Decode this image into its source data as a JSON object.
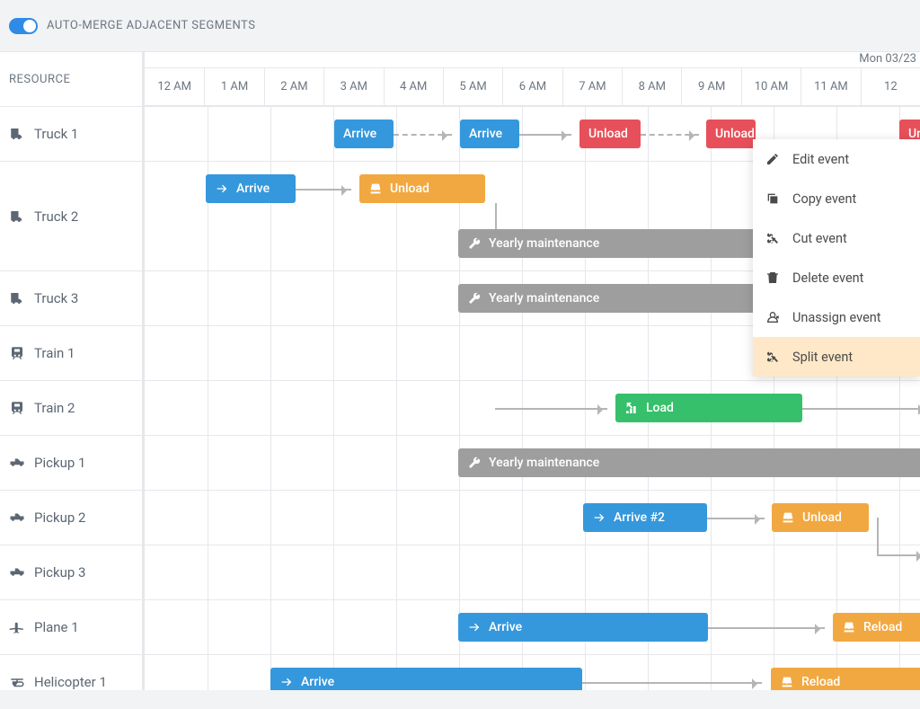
{
  "toolbar": {
    "auto_merge_label": "AUTO-MERGE ADJACENT SEGMENTS"
  },
  "header": {
    "resource": "RESOURCE",
    "date": "Mon 03/23"
  },
  "hours": [
    "12 AM",
    "1 AM",
    "2 AM",
    "3 AM",
    "4 AM",
    "5 AM",
    "6 AM",
    "7 AM",
    "8 AM",
    "9 AM",
    "10 AM",
    "11 AM",
    "12"
  ],
  "resources": [
    {
      "label": "Truck 1",
      "icon": "truck"
    },
    {
      "label": "Truck 2",
      "icon": "truck",
      "tall": true
    },
    {
      "label": "Truck 3",
      "icon": "truck"
    },
    {
      "label": "Train 1",
      "icon": "train"
    },
    {
      "label": "Train 2",
      "icon": "train"
    },
    {
      "label": "Pickup 1",
      "icon": "pickup"
    },
    {
      "label": "Pickup 2",
      "icon": "pickup"
    },
    {
      "label": "Pickup 3",
      "icon": "pickup"
    },
    {
      "label": "Plane 1",
      "icon": "plane"
    },
    {
      "label": "Helicopter 1",
      "icon": "helicopter"
    }
  ],
  "events": {
    "t1_arrive1": "Arrive",
    "t1_arrive2": "Arrive",
    "t1_unload1": "Unload",
    "t1_unload2": "Unload",
    "t1_unload3": "Un",
    "t2_arrive": "Arrive",
    "t2_unload": "Unload",
    "t2_maint": "Yearly maintenance",
    "t3_maint": "Yearly maintenance",
    "tr2_load": "Load",
    "p1_maint": "Yearly maintenance",
    "p2_arrive": "Arrive #2",
    "p2_unload": "Unload",
    "pl1_arrive": "Arrive",
    "pl1_reload": "Reload",
    "h1_arrive": "Arrive",
    "h1_reload": "Reload"
  },
  "menu": {
    "edit": "Edit event",
    "copy": "Copy event",
    "cut": "Cut event",
    "delete": "Delete event",
    "unassign": "Unassign event",
    "split": "Split event"
  }
}
